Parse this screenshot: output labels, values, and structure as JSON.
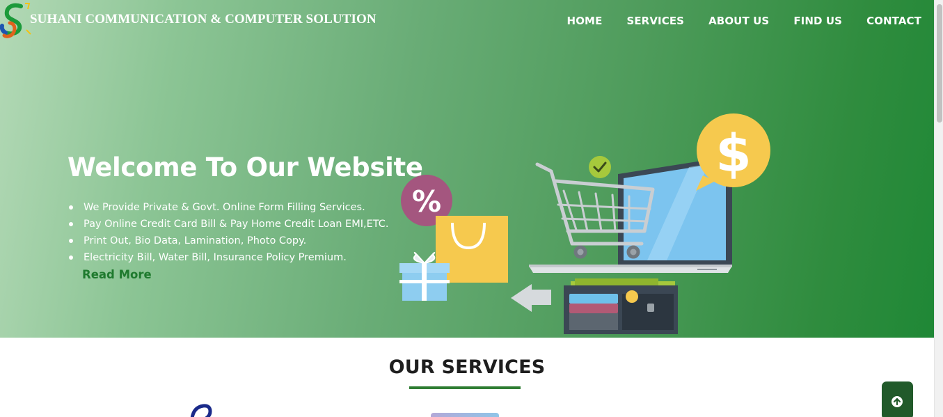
{
  "header": {
    "brand": "SUHANI COMMUNICATION & COMPUTER SOLUTION",
    "nav": [
      {
        "label": "HOME"
      },
      {
        "label": "SERVICES"
      },
      {
        "label": "ABOUT US"
      },
      {
        "label": "FIND US"
      },
      {
        "label": "CONTACT"
      }
    ]
  },
  "hero": {
    "title": "Welcome To Our Website",
    "bullets": [
      "We Provide Private & Govt. Online Form Filling Services.",
      "Pay Online Credit Card Bill & Pay Home Credit Loan EMI,ETC.",
      "Print Out, Bio Data, Lamination, Photo Copy.",
      "Electricity Bill, Water Bill, Insurance Policy Premium."
    ],
    "read_more": "Read More",
    "illustration": {
      "percent_badge": "%",
      "dollar_badge": "$"
    }
  },
  "services": {
    "title": "OUR SERVICES"
  },
  "icons": {
    "scroll_top": "arrow-up-circle-icon"
  },
  "colors": {
    "hero_gradient_start": "#b3d9b6",
    "hero_gradient_end": "#1f8836",
    "accent_green": "#2e7d32",
    "read_more_green": "#1f7a2e",
    "to_top_bg": "#215a2a"
  }
}
